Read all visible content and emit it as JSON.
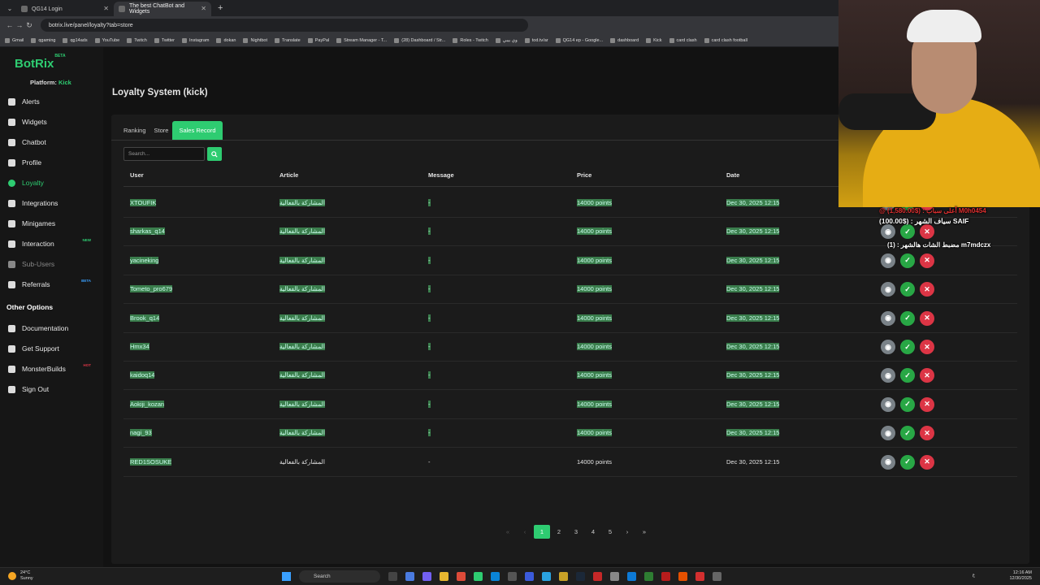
{
  "browser": {
    "tabs": [
      {
        "title": "QG14 Login",
        "active": false
      },
      {
        "title": "The best ChatBot and Widgets",
        "active": true
      }
    ],
    "url": "botrix.live/panel/loyalty?tab=store",
    "bookmarks": [
      "Gmail",
      "qgaming",
      "qg14ads",
      "YouTube",
      "Twitch",
      "Twitter",
      "Instagram",
      "dokan",
      "Nightbot",
      "Translate",
      "PayPal",
      "Stream Manager - T...",
      "(28) Dashboard / Str...",
      "Roles - Twitch",
      "وي بيبي",
      "tod.tv/ar",
      "QG14 ep - Google...",
      "dashboard",
      "Kick",
      "card clash",
      "card clash football"
    ]
  },
  "sidebar": {
    "logo": "BotRix",
    "logo_badge": "BETA",
    "platform_label": "Platform:",
    "platform_value": "Kick",
    "items": [
      {
        "label": "Alerts"
      },
      {
        "label": "Widgets"
      },
      {
        "label": "Chatbot"
      },
      {
        "label": "Profile"
      },
      {
        "label": "Loyalty"
      },
      {
        "label": "Integrations"
      },
      {
        "label": "Minigames"
      },
      {
        "label": "Interaction",
        "tag": "NEW"
      },
      {
        "label": "Sub-Users"
      },
      {
        "label": "Referrals",
        "tag": "BETA"
      }
    ],
    "other_title": "Other Options",
    "other_items": [
      {
        "label": "Documentation"
      },
      {
        "label": "Get Support"
      },
      {
        "label": "MonsterBuilds",
        "tag": "HOT"
      },
      {
        "label": "Sign Out"
      }
    ]
  },
  "main": {
    "title": "Loyalty System (kick)",
    "tabs": [
      "Ranking",
      "Store",
      "Sales Record"
    ],
    "search_placeholder": "Search...",
    "columns": [
      "User",
      "Article",
      "Message",
      "Price",
      "Date"
    ],
    "rows": [
      {
        "user": "XTOUFIK",
        "article": "المشاركة بالفعالية",
        "message": "-",
        "price": "14000 points",
        "date": "Dec 30, 2025 12:15"
      },
      {
        "user": "sharkas_q14",
        "article": "المشاركة بالفعالية",
        "message": "-",
        "price": "14000 points",
        "date": "Dec 30, 2025 12:15"
      },
      {
        "user": "yacineking",
        "article": "المشاركة بالفعالية",
        "message": "-",
        "price": "14000 points",
        "date": "Dec 30, 2025 12:15"
      },
      {
        "user": "Tometo_pro679",
        "article": "المشاركة بالفعالية",
        "message": "-",
        "price": "14000 points",
        "date": "Dec 30, 2025 12:15"
      },
      {
        "user": "Brook_q14",
        "article": "المشاركة بالفعالية",
        "message": "-",
        "price": "14000 points",
        "date": "Dec 30, 2025 12:15"
      },
      {
        "user": "Hmx34",
        "article": "المشاركة بالفعالية",
        "message": "-",
        "price": "14000 points",
        "date": "Dec 30, 2025 12:15"
      },
      {
        "user": "kaidoq14",
        "article": "المشاركة بالفعالية",
        "message": "-",
        "price": "14000 points",
        "date": "Dec 30, 2025 12:15"
      },
      {
        "user": "Aokiji_kozan",
        "article": "المشاركة بالفعالية",
        "message": "-",
        "price": "14000 points",
        "date": "Dec 30, 2025 12:15"
      },
      {
        "user": "nagi_93",
        "article": "المشاركة بالفعالية",
        "message": "-",
        "price": "14000 points",
        "date": "Dec 30, 2025 12:15"
      },
      {
        "user": "RED1SOSUKE",
        "article": "المشاركة بالفعالية",
        "message": "-",
        "price": "14000 points",
        "date": "Dec 30, 2025 12:15"
      }
    ],
    "pagination": {
      "first": "«",
      "prev": "‹",
      "pages": [
        "1",
        "2",
        "3",
        "4",
        "5"
      ],
      "current": "1",
      "next": "›",
      "last": "»"
    }
  },
  "overlay": {
    "line1": "@ أعلى سباب : ($1,580.00) M0h0454",
    "line2": "سياف الشهر : ($100.00) SAIF",
    "line3": "مضبط الشات هالشهر : (1) m7mdczx"
  },
  "taskbar": {
    "temp": "24°C",
    "weather": "Sunny",
    "search": "Search",
    "time": "12:16 AM",
    "date": "12/30/2025",
    "lang": "ع"
  }
}
